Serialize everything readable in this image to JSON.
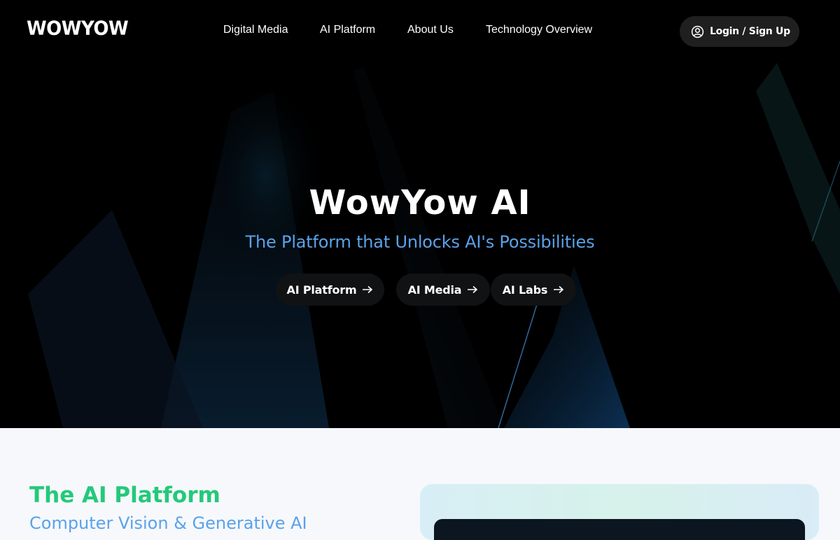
{
  "brand": {
    "logo_text": "WOWYOW"
  },
  "nav": {
    "links": [
      "Digital Media",
      "AI Platform",
      "About Us",
      "Technology Overview"
    ],
    "login_label": "Login / Sign Up"
  },
  "hero": {
    "title": "WowYow AI",
    "subtitle": "The Platform that Unlocks AI's Possibilities",
    "buttons": [
      "AI Platform",
      "AI Media",
      "AI Labs"
    ]
  },
  "section": {
    "title": "The AI Platform",
    "subtitle": "Computer Vision & Generative AI"
  },
  "colors": {
    "hero_bg": "#000000",
    "accent_blue": "#5aa2ea",
    "accent_green": "#24c97a",
    "page_bg": "#f6f8fb"
  },
  "icons": {
    "login": "user-circle-icon",
    "pill_arrow": "arrow-right-icon"
  }
}
